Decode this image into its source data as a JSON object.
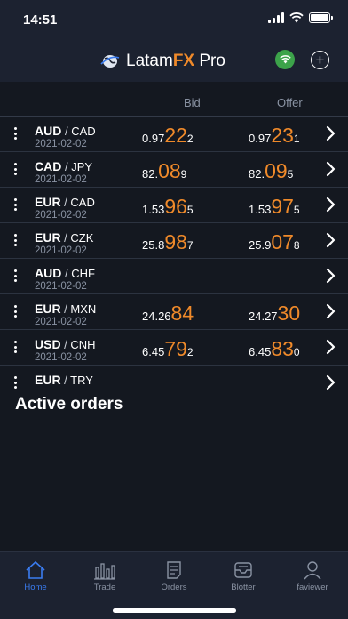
{
  "status": {
    "time": "14:51"
  },
  "header": {
    "brand_prefix": "Latam",
    "brand_fx": "FX",
    "brand_suffix": "Pro"
  },
  "columns": {
    "bid": "Bid",
    "offer": "Offer"
  },
  "rates": [
    {
      "base": "AUD",
      "sep": " / ",
      "quote": "CAD",
      "date": "2021-02-02",
      "bid": {
        "pre": "0.97",
        "big": "22",
        "post": "2"
      },
      "offer": {
        "pre": "0.97",
        "big": "23",
        "post": "1"
      }
    },
    {
      "base": "CAD",
      "sep": " / ",
      "quote": "JPY",
      "date": "2021-02-02",
      "bid": {
        "pre": "82.",
        "big": "08",
        "post": "9"
      },
      "offer": {
        "pre": "82.",
        "big": "09",
        "post": "5"
      }
    },
    {
      "base": "EUR",
      "sep": " / ",
      "quote": "CAD",
      "date": "2021-02-02",
      "bid": {
        "pre": "1.53",
        "big": "96",
        "post": "5"
      },
      "offer": {
        "pre": "1.53",
        "big": "97",
        "post": "5"
      }
    },
    {
      "base": "EUR",
      "sep": " / ",
      "quote": "CZK",
      "date": "2021-02-02",
      "bid": {
        "pre": "25.8",
        "big": "98",
        "post": "7"
      },
      "offer": {
        "pre": "25.9",
        "big": "07",
        "post": "8"
      }
    },
    {
      "base": "AUD",
      "sep": " / ",
      "quote": "CHF",
      "date": "2021-02-02",
      "bid": {
        "pre": "",
        "big": "",
        "post": ""
      },
      "offer": {
        "pre": "",
        "big": "",
        "post": ""
      }
    },
    {
      "base": "EUR",
      "sep": " / ",
      "quote": "MXN",
      "date": "2021-02-02",
      "bid": {
        "pre": "24.26",
        "big": "84",
        "post": ""
      },
      "offer": {
        "pre": "24.27",
        "big": "30",
        "post": ""
      }
    },
    {
      "base": "USD",
      "sep": " / ",
      "quote": "CNH",
      "date": "2021-02-02",
      "bid": {
        "pre": "6.45",
        "big": "79",
        "post": "2"
      },
      "offer": {
        "pre": "6.45",
        "big": "83",
        "post": "0"
      }
    },
    {
      "base": "EUR",
      "sep": " / ",
      "quote": "TRY",
      "date": "",
      "bid": {
        "pre": "",
        "big": "",
        "post": ""
      },
      "offer": {
        "pre": "",
        "big": "",
        "post": ""
      }
    }
  ],
  "active_orders_title": "Active orders",
  "tabs": [
    {
      "label": "Home",
      "icon": "home-icon"
    },
    {
      "label": "Trade",
      "icon": "bar-chart-icon"
    },
    {
      "label": "Orders",
      "icon": "orders-icon"
    },
    {
      "label": "Blotter",
      "icon": "inbox-icon"
    },
    {
      "label": "faviewer",
      "icon": "user-icon"
    }
  ],
  "colors": {
    "accent": "#f08a2a",
    "active_tab": "#3a7cf0",
    "connected": "#3ca34a"
  }
}
